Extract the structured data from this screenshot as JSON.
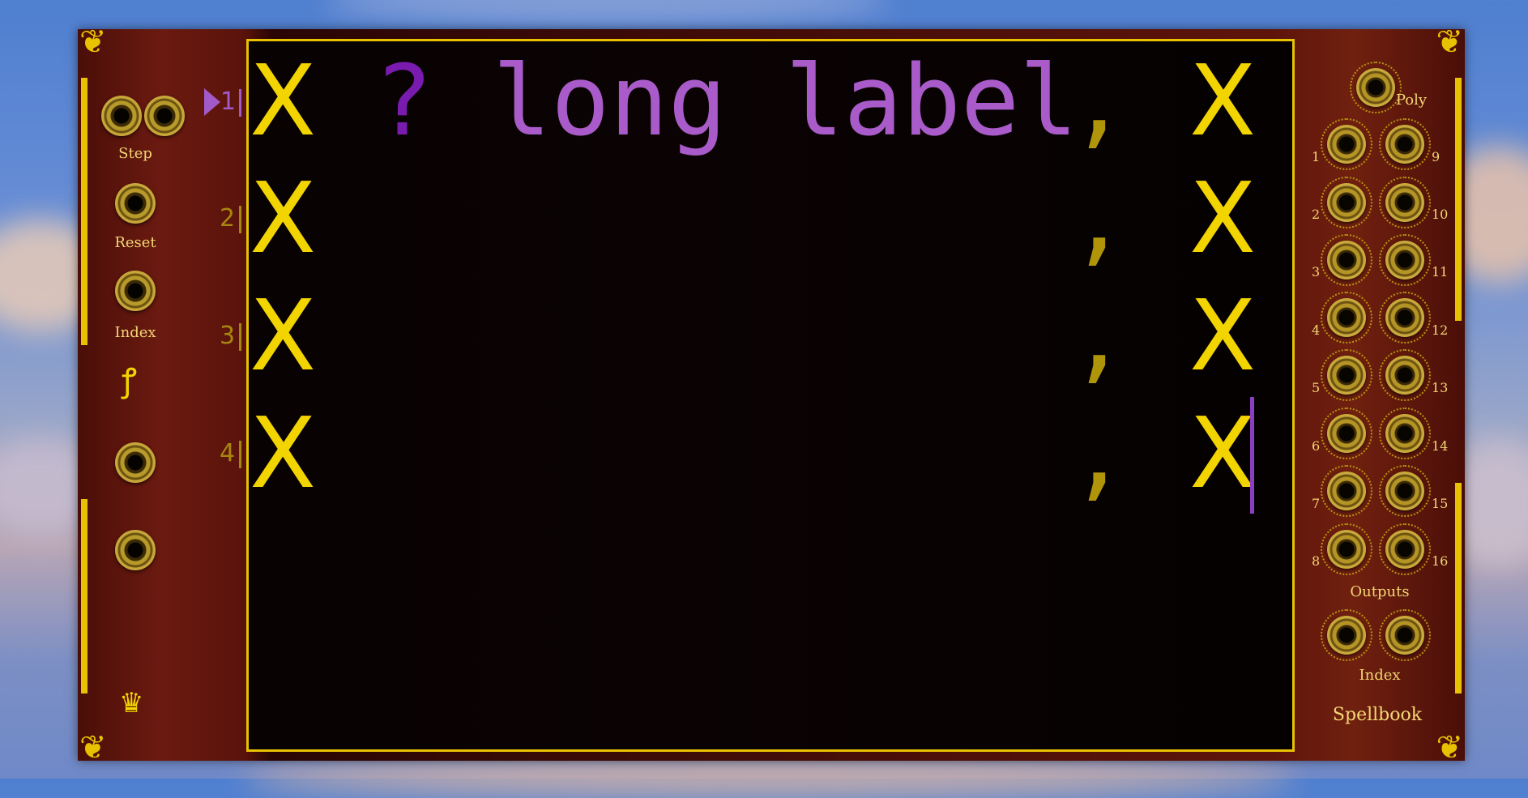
{
  "app": {
    "name": "Spellbook"
  },
  "left": {
    "step_label": "Step",
    "reset_label": "Reset",
    "index_label": "Index",
    "row_numbers": [
      "1",
      "2",
      "3",
      "4"
    ],
    "active_row": "1"
  },
  "display": {
    "rows": [
      {
        "left": "X",
        "q": "?",
        "label": "long label",
        "comma": ",",
        "right": "X"
      },
      {
        "left": "X",
        "q": "",
        "label": "",
        "comma": ",",
        "right": "X"
      },
      {
        "left": "X",
        "q": "",
        "label": "",
        "comma": ",",
        "right": "X"
      },
      {
        "left": "X",
        "q": "",
        "label": "",
        "comma": ",",
        "right": "X"
      }
    ],
    "colors": {
      "accent": "#f2d400",
      "label": "#a85bc9",
      "frame": "#e8c200"
    }
  },
  "right": {
    "poly_label": "Poly",
    "outputs_label": "Outputs",
    "index_label": "Index",
    "title": "Spellbook",
    "left_numbers": [
      "1",
      "2",
      "3",
      "4",
      "5",
      "6",
      "7",
      "8"
    ],
    "right_numbers": [
      "9",
      "10",
      "11",
      "12",
      "13",
      "14",
      "15",
      "16"
    ]
  }
}
